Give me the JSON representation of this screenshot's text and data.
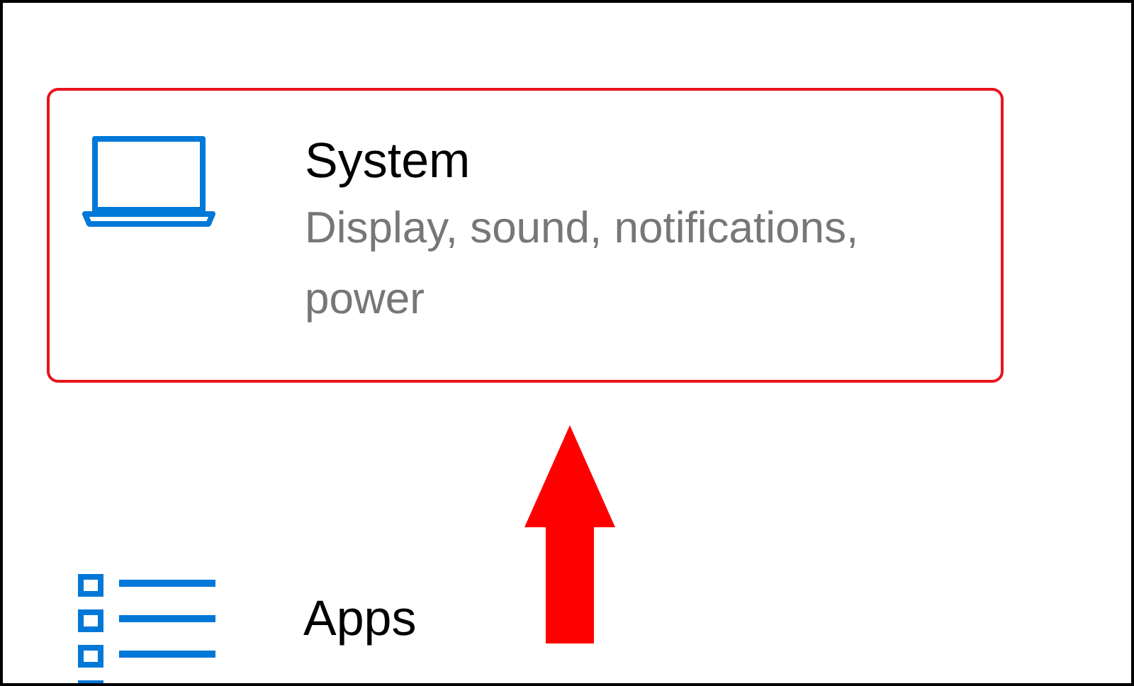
{
  "items": [
    {
      "kind": "system",
      "title": "System",
      "description": "Display, sound, notifications, power",
      "highlighted": true
    },
    {
      "kind": "apps",
      "title": "Apps",
      "highlighted": false
    }
  ]
}
